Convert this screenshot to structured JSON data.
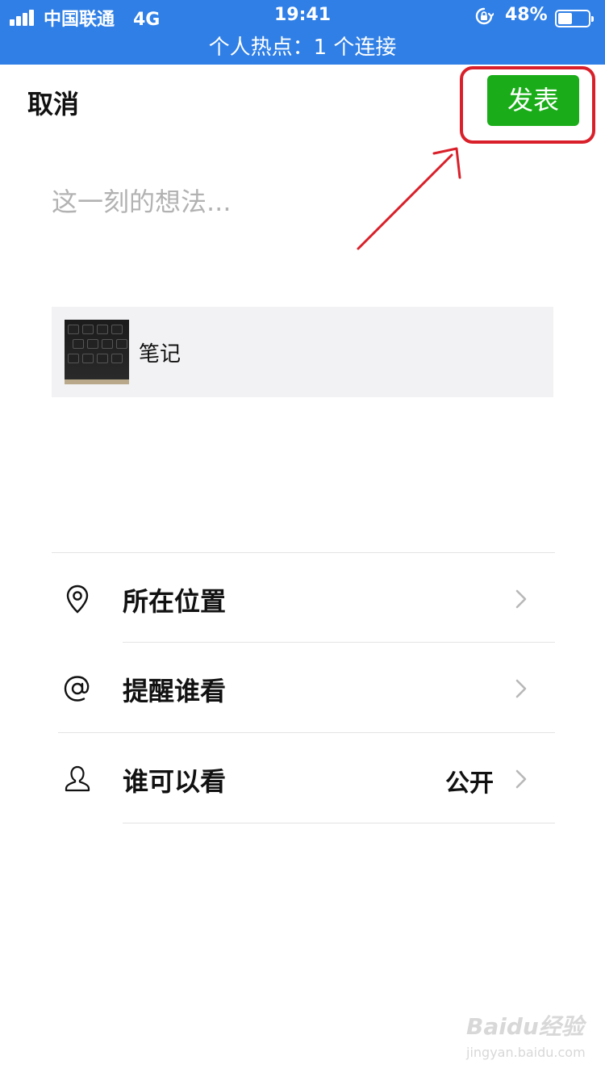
{
  "status_bar": {
    "carrier": "中国联通",
    "network": "4G",
    "time": "19:41",
    "battery_percent_label": "48%",
    "battery_level": 0.48,
    "hotspot_text": "个人热点：1 个连接",
    "background_color": "#2f7fe6"
  },
  "header": {
    "cancel_label": "取消",
    "publish_label": "发表",
    "publish_color": "#1aad19"
  },
  "compose": {
    "placeholder": "这一刻的想法..."
  },
  "link_card": {
    "title": "笔记"
  },
  "options": [
    {
      "label": "所在位置",
      "icon": "location-pin-icon",
      "value": ""
    },
    {
      "label": "提醒谁看",
      "icon": "at-sign-icon",
      "value": ""
    },
    {
      "label": "谁可以看",
      "icon": "person-icon",
      "value": "公开"
    }
  ],
  "annotation": {
    "highlight_color": "#d9202a"
  },
  "watermark": {
    "brand": "Baidu经验",
    "url": "jingyan.baidu.com"
  }
}
